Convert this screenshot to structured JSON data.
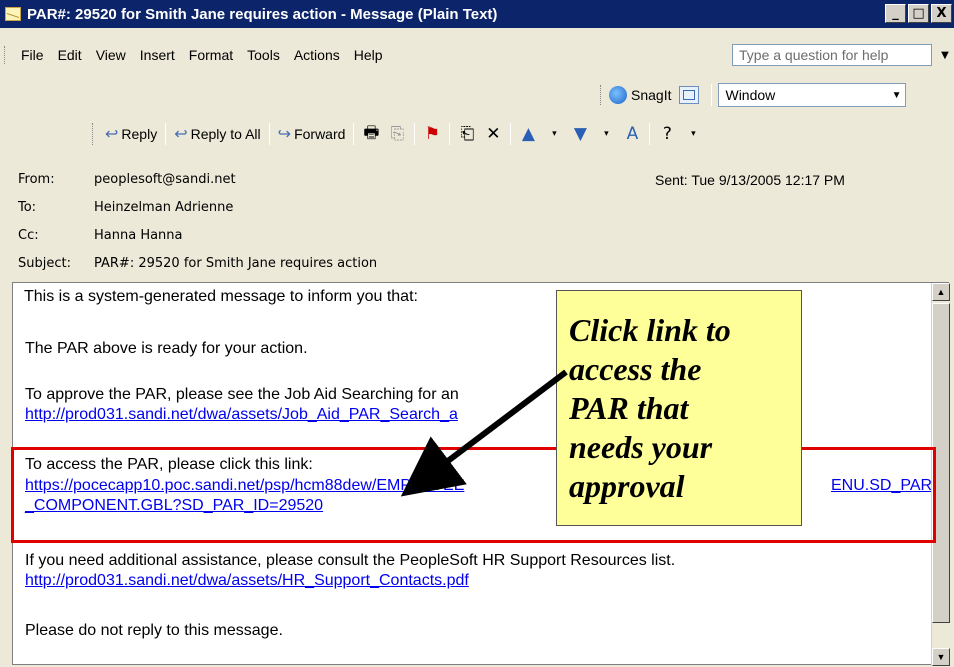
{
  "window": {
    "title": "PAR#: 29520 for Smith Jane requires action  - Message (Plain Text)",
    "min_label": "_",
    "max_label": "□",
    "close_label": "X"
  },
  "menu": {
    "items": [
      "File",
      "Edit",
      "View",
      "Insert",
      "Format",
      "Tools",
      "Actions",
      "Help"
    ],
    "help_placeholder": "Type a question for help"
  },
  "snagit": {
    "label": "SnagIt",
    "window_value": "Window"
  },
  "toolbar": {
    "reply": "Reply",
    "reply_all": "Reply to All",
    "forward": "Forward"
  },
  "header": {
    "from_label": "From:",
    "from_value": "peoplesoft@sandi.net",
    "to_label": "To:",
    "to_value": "Heinzelman Adrienne",
    "cc_label": "Cc:",
    "cc_value": "Hanna Hanna",
    "subject_label": "Subject:",
    "subject_value": "PAR#: 29520 for Smith Jane requires action",
    "sent": "Sent:  Tue 9/13/2005 12:17 PM"
  },
  "body": {
    "line1": "This is a system-generated message to inform you that:",
    "line2": "The PAR above is ready for your action.",
    "line3": "To approve the PAR, please see the Job Aid Searching for an",
    "link1": "http://prod031.sandi.net/dwa/assets/Job_Aid_PAR_Search_a",
    "line4": "To access the PAR, please click this link:",
    "link2a": "https://pocecapp10.poc.sandi.net/psp/hcm88dew/EMPLOYEE",
    "link2a_tail": "ENU.SD_PAR",
    "link2b": "_COMPONENT.GBL?SD_PAR_ID=29520",
    "line5": "If you need additional assistance, please consult the PeopleSoft HR Support Resources list.",
    "link3": "http://prod031.sandi.net/dwa/assets/HR_Support_Contacts.pdf",
    "line6": "Please do not reply to this message."
  },
  "callout": {
    "lines": [
      "Click link to",
      "access the",
      "PAR that",
      "needs your",
      "approval"
    ]
  }
}
